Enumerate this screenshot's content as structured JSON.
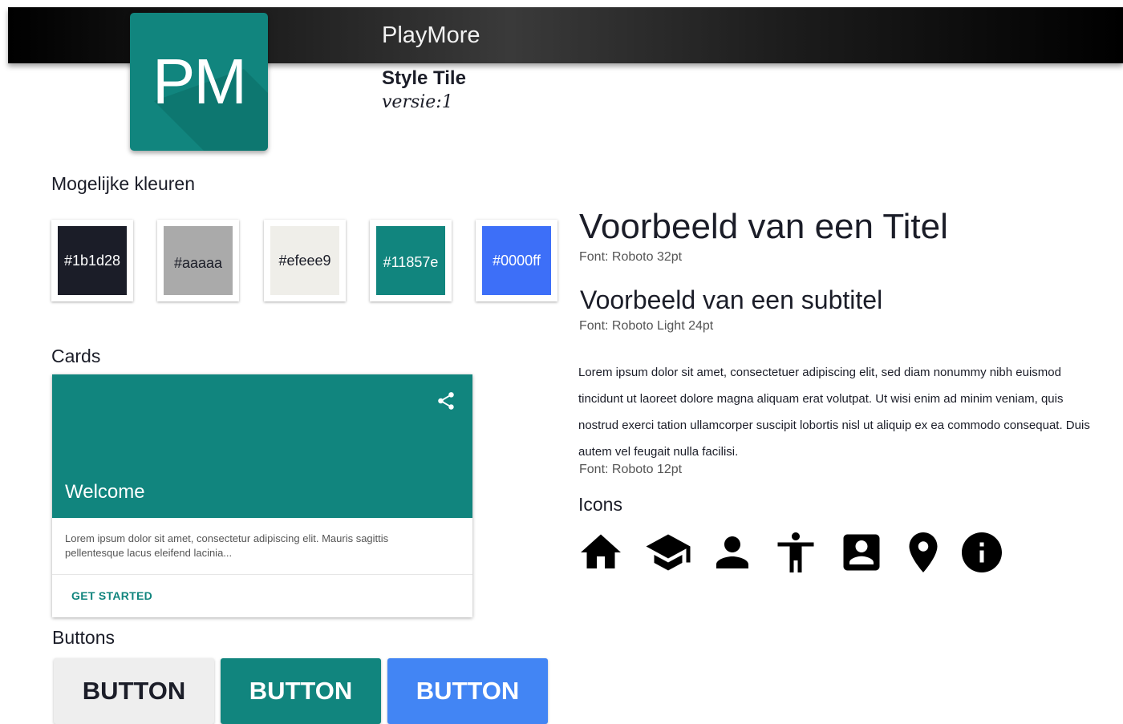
{
  "header": {
    "app_name": "PlayMore"
  },
  "logo": {
    "text": "PM",
    "color": "#11857e"
  },
  "tile": {
    "title": "Style Tile",
    "version": "versie:1"
  },
  "colors": {
    "heading": "Mogelijke kleuren",
    "swatches": [
      {
        "label": "#1b1d28",
        "color": "#1b1d28",
        "text_color": "#ffffff"
      },
      {
        "label": "#aaaaa",
        "color": "#aaaaaa",
        "text_color": "#1b1d28"
      },
      {
        "label": "#efeee9",
        "color": "#efeee9",
        "text_color": "#1b1d28"
      },
      {
        "label": "#11857e",
        "color": "#11857e",
        "text_color": "#ffffff"
      },
      {
        "label": "#0000ff",
        "color": "#3d6ff8",
        "text_color": "#ffffff"
      }
    ]
  },
  "cards": {
    "heading": "Cards",
    "card": {
      "title": "Welcome",
      "text": "Lorem ipsum dolor sit amet, consectetur adipiscing elit. Mauris sagittis pellentesque lacus eleifend lacinia...",
      "action": "GET STARTED",
      "icon": "share-icon"
    }
  },
  "buttons": {
    "heading": "Buttons",
    "items": [
      {
        "label": "BUTTON",
        "color": "#eeeeee",
        "text_color": "#1b1d28"
      },
      {
        "label": "BUTTON",
        "color": "#11857e",
        "text_color": "#ffffff"
      },
      {
        "label": "BUTTON",
        "color": "#4285f4",
        "text_color": "#ffffff"
      }
    ]
  },
  "typography": {
    "title": "Voorbeeld van een Titel",
    "title_font": "Font: Roboto 32pt",
    "subtitle": "Voorbeeld van een subtitel",
    "subtitle_font": "Font: Roboto Light 24pt",
    "body": "Lorem ipsum dolor sit amet, consectetuer adipiscing elit, sed diam nonummy nibh euismod tincidunt ut laoreet dolore magna aliquam erat volutpat. Ut wisi enim ad minim veniam, quis nostrud exerci tation ullamcorper suscipit lobortis nisl ut aliquip ex ea commodo consequat. Duis autem vel feugait nulla facilisi.",
    "body_font": "Font: Roboto 12pt"
  },
  "icons": {
    "heading": "Icons",
    "items": [
      "home-icon",
      "school-icon",
      "person-icon",
      "accessibility-icon",
      "contact-icon",
      "location-pin-icon",
      "info-icon"
    ]
  }
}
